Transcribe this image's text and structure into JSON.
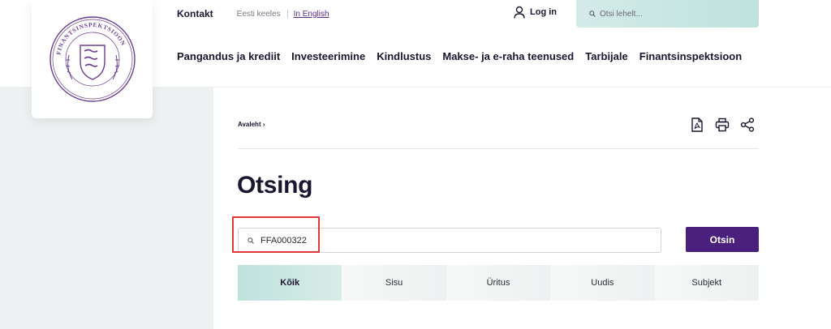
{
  "brand": {
    "logo_text": "FINANTSINSPEKTSIOON",
    "colors": {
      "primary": "#4b1f7c",
      "accent": "#bfe2dc",
      "text": "#1c1530",
      "highlight": "#e03a36"
    }
  },
  "topbar": {
    "contact": "Kontakt",
    "lang_et": "Eesti keeles",
    "lang_en": "In English",
    "login": "Log in",
    "login_icon": "user-icon",
    "search_placeholder": "Otsi lehelt...",
    "search_icon": "search-icon"
  },
  "nav": {
    "items": [
      "Pangandus ja krediit",
      "Investeerimine",
      "Kindlustus",
      "Makse- ja e-raha teenused",
      "Tarbijale",
      "Finantsinspektsioon"
    ]
  },
  "breadcrumb": {
    "home": "Avaleht",
    "separator": "›"
  },
  "tools": {
    "pdf_icon": "pdf-icon",
    "print_icon": "print-icon",
    "share_icon": "share-icon"
  },
  "page": {
    "title": "Otsing"
  },
  "search": {
    "value": "FFA000322",
    "submit": "Otsin"
  },
  "tabs": [
    {
      "label": "Kõik",
      "active": true
    },
    {
      "label": "Sisu",
      "active": false
    },
    {
      "label": "Üritus",
      "active": false
    },
    {
      "label": "Uudis",
      "active": false
    },
    {
      "label": "Subjekt",
      "active": false
    }
  ]
}
